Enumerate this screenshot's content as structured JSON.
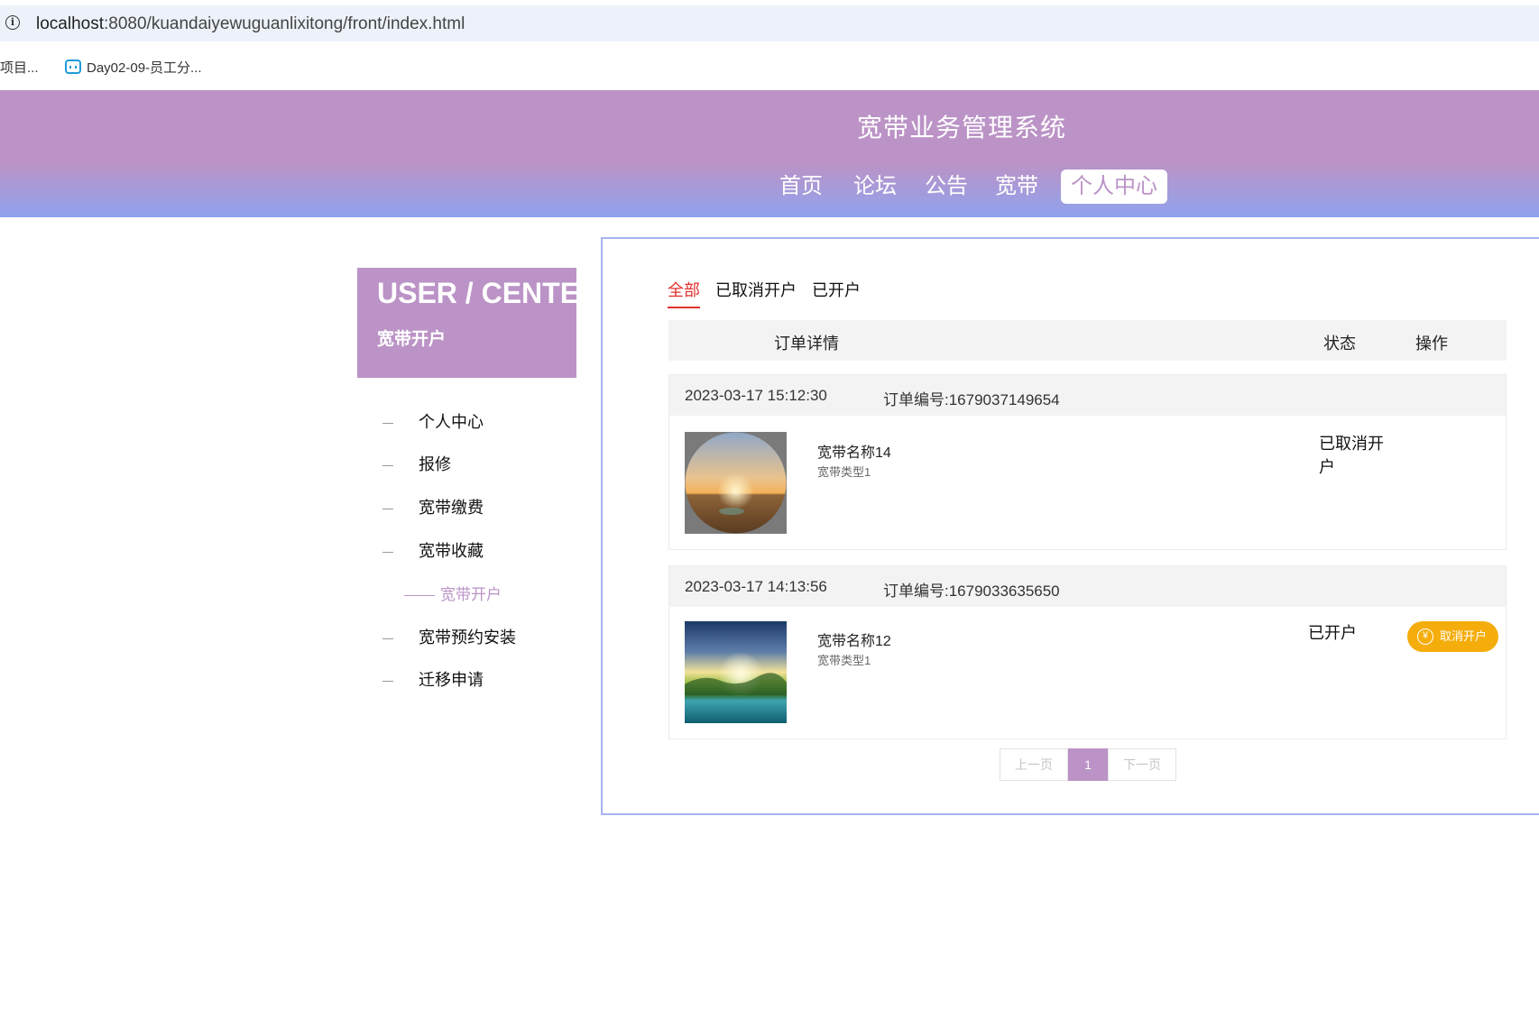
{
  "browser": {
    "url_host": "localhost",
    "url_rest": ":8080/kuandaiyewuguanlixitong/front/index.html",
    "bookmarks": [
      "项目...",
      "Day02-09-员工分..."
    ]
  },
  "header": {
    "title": "宽带业务管理系统",
    "nav": [
      "首页",
      "论坛",
      "公告",
      "宽带",
      "个人中心"
    ],
    "active_nav": "个人中心"
  },
  "sidebar": {
    "title": "USER / CENTER",
    "subtitle": "宽带开户",
    "items": [
      "个人中心",
      "报修",
      "宽带缴费",
      "宽带收藏",
      "宽带开户",
      "宽带预约安装",
      "迁移申请"
    ],
    "active_item": "宽带开户"
  },
  "tabs": [
    "全部",
    "已取消开户",
    "已开户"
  ],
  "active_tab": "全部",
  "table": {
    "headers": [
      "订单详情",
      "状态",
      "操作"
    ]
  },
  "orders": [
    {
      "time": "2023-03-17 15:12:30",
      "order_no": "订单编号:1679037149654",
      "name": "宽带名称14",
      "type": "宽带类型1",
      "status_line1": "已取消开",
      "status_line2": "户",
      "image": "desert-sunset"
    },
    {
      "time": "2023-03-17 14:13:56",
      "order_no": "订单编号:1679033635650",
      "name": "宽带名称12",
      "type": "宽带类型1",
      "status": "已开户",
      "action": "取消开户",
      "image": "lake-sunrise"
    }
  ],
  "pager": {
    "prev": "上一页",
    "current": "1",
    "next": "下一页"
  },
  "colors": {
    "accent": "#bb93c6",
    "active_tab": "#e0312b",
    "button": "#f5ad0c",
    "panel_border": "#a7b3f0"
  }
}
